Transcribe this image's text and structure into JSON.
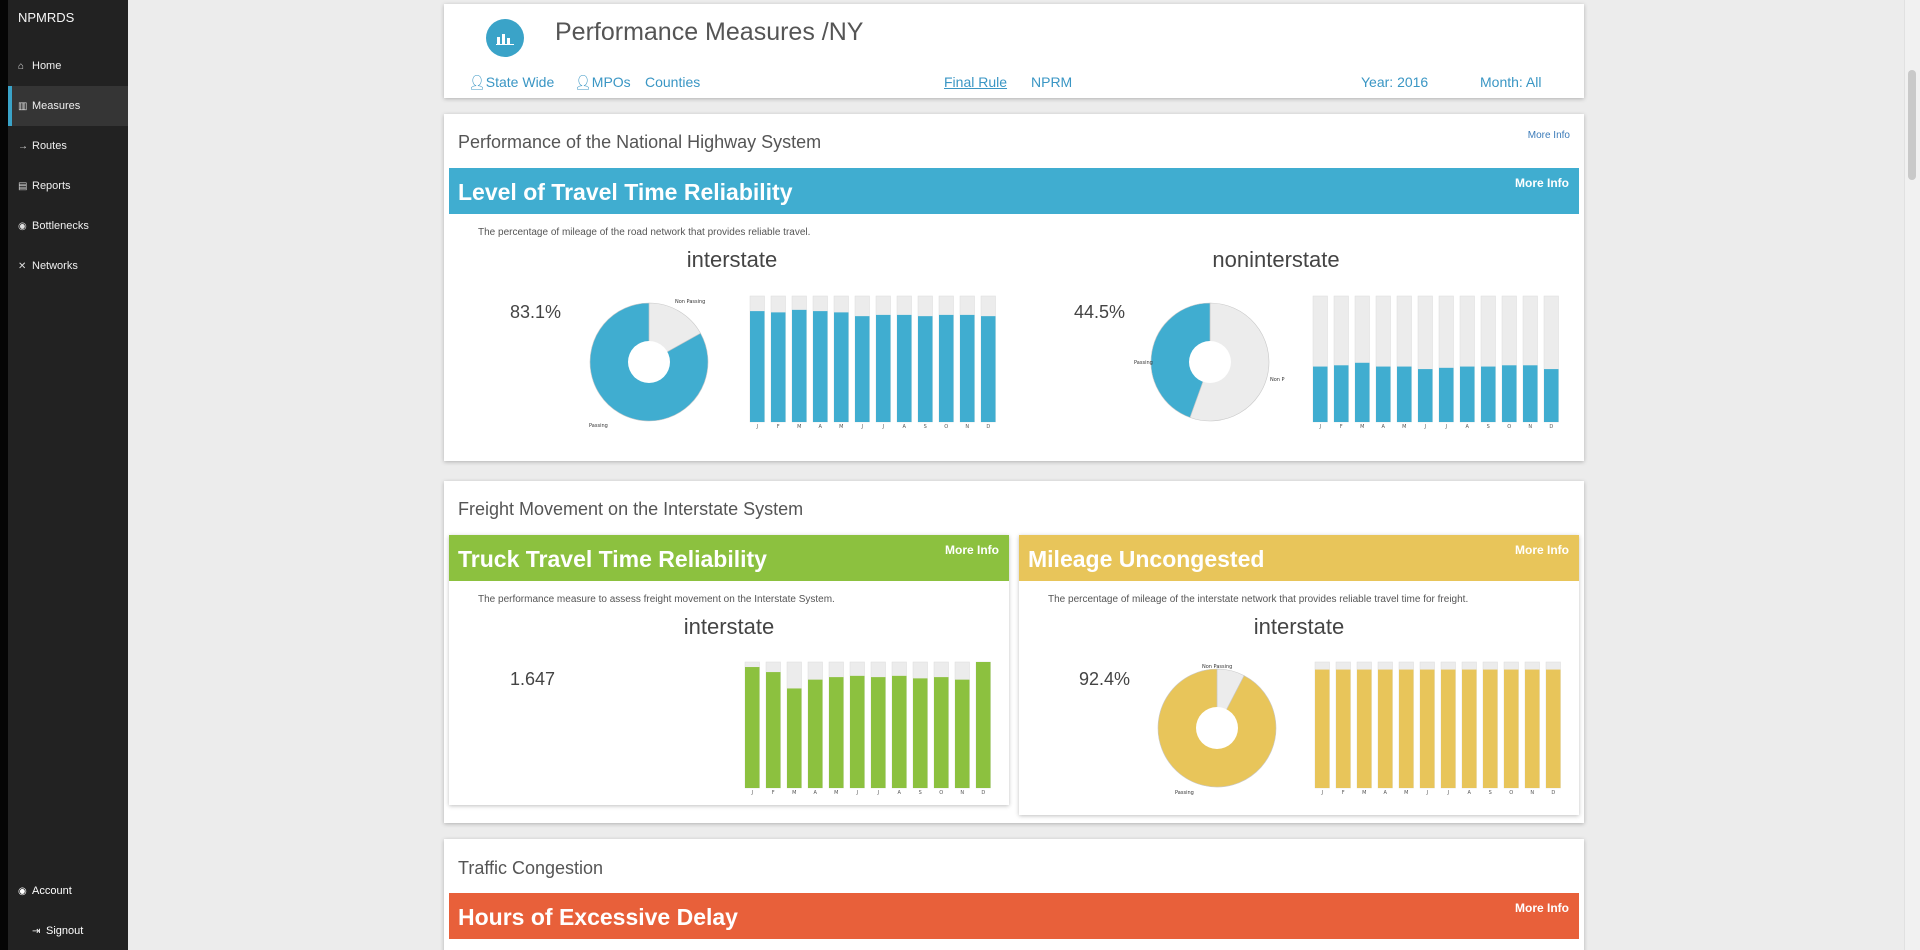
{
  "app": {
    "brand": "NPMRDS"
  },
  "sidebar": {
    "items": [
      {
        "label": "Home",
        "icon": "home-icon",
        "glyph": "⌂"
      },
      {
        "label": "Measures",
        "icon": "bar-chart-icon",
        "glyph": "▥",
        "active": true
      },
      {
        "label": "Routes",
        "icon": "arrow-right-icon",
        "glyph": "→"
      },
      {
        "label": "Reports",
        "icon": "file-icon",
        "glyph": "▤"
      },
      {
        "label": "Bottlenecks",
        "icon": "dashboard-icon",
        "glyph": "◉"
      },
      {
        "label": "Networks",
        "icon": "random-icon",
        "glyph": "✕"
      }
    ],
    "account": "Account",
    "signout": "Signout"
  },
  "header": {
    "title": "Performance Measures /NY",
    "links": [
      "State Wide",
      "MPOs",
      "Counties"
    ],
    "rule_links": [
      "Final Rule",
      "NPRM"
    ],
    "year": "Year: 2016",
    "month": "Month: All"
  },
  "more_info": "More Info",
  "sections": {
    "nhs": {
      "title": "Performance of the National Highway System",
      "band_title": "Level of Travel Time Reliability",
      "description": "The percentage of mileage of the road network that provides reliable travel.",
      "interstate": {
        "title": "interstate",
        "value": "83.1%",
        "pie_labels": [
          "Non Passing",
          "Passing"
        ]
      },
      "noninterstate": {
        "title": "noninterstate",
        "value": "44.5%",
        "pie_labels": [
          "Passing",
          "Non P"
        ]
      }
    },
    "freight": {
      "title": "Freight Movement on the Interstate System",
      "truck": {
        "band_title": "Truck Travel Time Reliability",
        "description": "The performance measure to assess freight movement on the Interstate System.",
        "chart_title": "interstate",
        "value": "1.647"
      },
      "mileage": {
        "band_title": "Mileage Uncongested",
        "description": "The percentage of mileage of the interstate network that provides reliable travel time for freight.",
        "chart_title": "interstate",
        "value": "92.4%",
        "pie_labels": [
          "Non Passing",
          "Passing"
        ]
      }
    },
    "congestion": {
      "title": "Traffic Congestion",
      "band_title": "Hours of Excessive Delay"
    }
  },
  "colors": {
    "blue": "#40add0",
    "green": "#8cc13f",
    "yellow": "#e8c55a",
    "orange": "#e8603a",
    "empty": "#ececec"
  },
  "chart_data": [
    {
      "type": "pie",
      "name": "lottr-interstate-pie",
      "labels": [
        "Passing",
        "Non Passing"
      ],
      "values": [
        83.1,
        16.9
      ]
    },
    {
      "type": "bar",
      "name": "lottr-interstate-monthly",
      "categories": [
        "J",
        "F",
        "M",
        "A",
        "M",
        "J",
        "J",
        "A",
        "S",
        "O",
        "N",
        "D"
      ],
      "values": [
        0.88,
        0.87,
        0.89,
        0.88,
        0.87,
        0.84,
        0.85,
        0.85,
        0.84,
        0.85,
        0.85,
        0.84
      ],
      "ylim": [
        0,
        1
      ]
    },
    {
      "type": "pie",
      "name": "lottr-noninterstate-pie",
      "labels": [
        "Passing",
        "Non Passing"
      ],
      "values": [
        44.5,
        55.5
      ]
    },
    {
      "type": "bar",
      "name": "lottr-noninterstate-monthly",
      "categories": [
        "J",
        "F",
        "M",
        "A",
        "M",
        "J",
        "J",
        "A",
        "S",
        "O",
        "N",
        "D"
      ],
      "values": [
        0.44,
        0.45,
        0.47,
        0.44,
        0.44,
        0.42,
        0.43,
        0.44,
        0.44,
        0.45,
        0.45,
        0.42
      ],
      "ylim": [
        0,
        1
      ]
    },
    {
      "type": "bar",
      "name": "ttr-interstate-monthly",
      "categories": [
        "J",
        "F",
        "M",
        "A",
        "M",
        "J",
        "J",
        "A",
        "S",
        "O",
        "N",
        "D"
      ],
      "values": [
        0.96,
        0.92,
        0.79,
        0.86,
        0.88,
        0.89,
        0.88,
        0.89,
        0.87,
        0.88,
        0.86,
        1.0
      ],
      "ylim": [
        0,
        1
      ]
    },
    {
      "type": "pie",
      "name": "mileage-uncongested-pie",
      "labels": [
        "Passing",
        "Non Passing"
      ],
      "values": [
        92.4,
        7.6
      ]
    },
    {
      "type": "bar",
      "name": "mileage-uncongested-monthly",
      "categories": [
        "J",
        "F",
        "M",
        "A",
        "M",
        "J",
        "J",
        "A",
        "S",
        "O",
        "N",
        "D"
      ],
      "values": [
        0.94,
        0.94,
        0.94,
        0.94,
        0.94,
        0.94,
        0.94,
        0.94,
        0.94,
        0.94,
        0.94,
        0.94
      ],
      "ylim": [
        0,
        1
      ]
    }
  ]
}
